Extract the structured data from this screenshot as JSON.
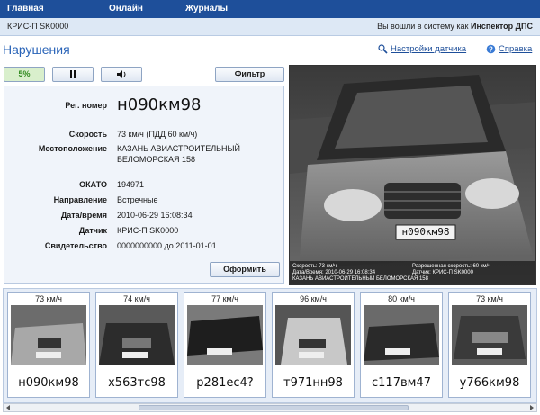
{
  "nav": {
    "items": [
      {
        "label": "Главная"
      },
      {
        "label": "Онлайн"
      },
      {
        "label": "Журналы"
      }
    ]
  },
  "userbar": {
    "device": "КРИС-П SK0000",
    "login_prefix": "Вы вошли в систему как",
    "user": "Инспектор ДПС"
  },
  "page": {
    "title": "Нарушения",
    "settings_link": "Настройки датчика",
    "help_link": "Справка"
  },
  "toolbar": {
    "progress": "5%",
    "pause_icon": "pause-icon",
    "sound_icon": "speaker-icon",
    "filter_label": "Фильтр"
  },
  "violation": {
    "reg_label": "Рег. номер",
    "reg_value": "н090км98",
    "speed_label": "Скорость",
    "speed_value": "73 км/ч (ПДД 60 км/ч)",
    "location_label": "Местоположение",
    "location_line1": "КАЗАНЬ АВИАСТРОИТЕЛЬНЫЙ",
    "location_line2": "БЕЛОМОРСКАЯ 158",
    "okato_label": "ОКАТО",
    "okato_value": "194971",
    "direction_label": "Направление",
    "direction_value": "Встречные",
    "datetime_label": "Дата/время",
    "datetime_value": "2010-06-29 16:08:34",
    "sensor_label": "Датчик",
    "sensor_value": "КРИС-П SK0000",
    "certificate_label": "Свидетельство",
    "certificate_value": "0000000000 до 2011-01-01",
    "submit_label": "Оформить"
  },
  "photo": {
    "plate": "н090км98",
    "caption_speed": "Скорость: 73 км/ч",
    "caption_datetime": "Дата/Время: 2010-06-29 16:08:34",
    "caption_location": "КАЗАНЬ АВИАСТРОИТЕЛЬНЫЙ БЕЛОМОРСКАЯ 158",
    "caption_allowed": "Разрешенная скорость: 60 км/ч",
    "caption_sensor": "Датчик:   КРИС-П SK0000"
  },
  "thumbnails": [
    {
      "speed": "73 км/ч",
      "plate": "н090км98"
    },
    {
      "speed": "74 км/ч",
      "plate": "х563тс98"
    },
    {
      "speed": "77 км/ч",
      "plate": "р281ес4?"
    },
    {
      "speed": "96 км/ч",
      "plate": "т971нн98"
    },
    {
      "speed": "80 км/ч",
      "plate": "с117вм47"
    },
    {
      "speed": "73 км/ч",
      "plate": "у766км98"
    }
  ],
  "colors": {
    "nav_bg": "#1e4f9a",
    "accent": "#2a64b8",
    "progress_text": "#2f8a1d"
  }
}
